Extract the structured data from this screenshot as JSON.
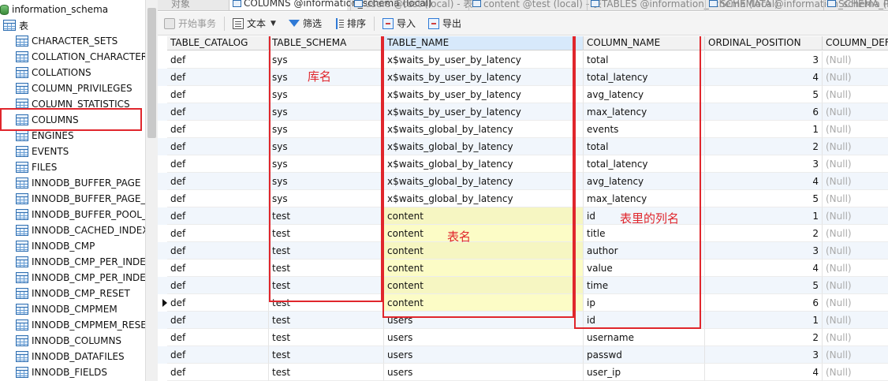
{
  "sidebar": {
    "database": "information_schema",
    "group_label": "表",
    "items": [
      "CHARACTER_SETS",
      "COLLATION_CHARACTER_SET_APPLICABILITY",
      "COLLATIONS",
      "COLUMN_PRIVILEGES",
      "COLUMN_STATISTICS",
      "COLUMNS",
      "ENGINES",
      "EVENTS",
      "FILES",
      "INNODB_BUFFER_PAGE",
      "INNODB_BUFFER_PAGE_LRU",
      "INNODB_BUFFER_POOL_STATS",
      "INNODB_CACHED_INDEXES",
      "INNODB_CMP",
      "INNODB_CMP_PER_INDEX",
      "INNODB_CMP_PER_INDEX_RESET",
      "INNODB_CMP_RESET",
      "INNODB_CMPMEM",
      "INNODB_CMPMEM_RESET",
      "INNODB_COLUMNS",
      "INNODB_DATAFILES",
      "INNODB_FIELDS"
    ],
    "selected_item": "COLUMNS"
  },
  "tabs": [
    {
      "label": "对象"
    },
    {
      "label": "COLUMNS @information_schema (local)"
    },
    {
      "label": "users @test (local) - 表"
    },
    {
      "label": "content @test (local) - 表"
    },
    {
      "label": "TABLES @information_schema (local)"
    },
    {
      "label": "SCHEMATA @information_schema (local)"
    },
    {
      "label": "SCHEMA_PRIVILEGES"
    }
  ],
  "toolbar": {
    "begin_transaction": "开始事务",
    "text": "文本",
    "filter": "筛选",
    "sort": "排序",
    "import": "导入",
    "export": "导出"
  },
  "grid": {
    "columns": [
      "TABLE_CATALOG",
      "TABLE_SCHEMA",
      "TABLE_NAME",
      "COLUMN_NAME",
      "ORDINAL_POSITION",
      "COLUMN_DEFAULT"
    ],
    "null_text": "(Null)",
    "current_row_index": 14,
    "rows": [
      [
        "def",
        "sys",
        "x$waits_by_user_by_latency",
        "total",
        "3"
      ],
      [
        "def",
        "sys",
        "x$waits_by_user_by_latency",
        "total_latency",
        "4"
      ],
      [
        "def",
        "sys",
        "x$waits_by_user_by_latency",
        "avg_latency",
        "5"
      ],
      [
        "def",
        "sys",
        "x$waits_by_user_by_latency",
        "max_latency",
        "6"
      ],
      [
        "def",
        "sys",
        "x$waits_global_by_latency",
        "events",
        "1"
      ],
      [
        "def",
        "sys",
        "x$waits_global_by_latency",
        "total",
        "2"
      ],
      [
        "def",
        "sys",
        "x$waits_global_by_latency",
        "total_latency",
        "3"
      ],
      [
        "def",
        "sys",
        "x$waits_global_by_latency",
        "avg_latency",
        "4"
      ],
      [
        "def",
        "sys",
        "x$waits_global_by_latency",
        "max_latency",
        "5"
      ],
      [
        "def",
        "test",
        "content",
        "id",
        "1"
      ],
      [
        "def",
        "test",
        "content",
        "title",
        "2"
      ],
      [
        "def",
        "test",
        "content",
        "author",
        "3"
      ],
      [
        "def",
        "test",
        "content",
        "value",
        "4"
      ],
      [
        "def",
        "test",
        "content",
        "time",
        "5"
      ],
      [
        "def",
        "test",
        "content",
        "ip",
        "6"
      ],
      [
        "def",
        "test",
        "users",
        "id",
        "1"
      ],
      [
        "def",
        "test",
        "users",
        "username",
        "2"
      ],
      [
        "def",
        "test",
        "users",
        "passwd",
        "3"
      ],
      [
        "def",
        "test",
        "users",
        "user_ip",
        "4"
      ]
    ]
  },
  "annotations": {
    "schema_label": "库名",
    "table_label": "表名",
    "column_label": "表里的列名",
    "color": "#e0262c"
  }
}
